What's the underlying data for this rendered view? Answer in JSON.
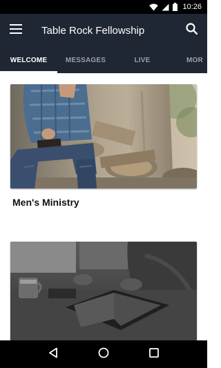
{
  "status_bar": {
    "time": "10:26",
    "icons": [
      "wifi-icon",
      "signal-icon",
      "battery-icon"
    ]
  },
  "app_bar": {
    "title": "Table Rock Fellowship",
    "icons": [
      "menu-icon",
      "search-icon"
    ]
  },
  "tabs": [
    {
      "label": "WELCOME",
      "active": true
    },
    {
      "label": "MESSAGES",
      "active": false
    },
    {
      "label": "LIVE",
      "active": false
    },
    {
      "label": "MOR",
      "active": false
    }
  ],
  "cards": [
    {
      "title": "Men's Ministry",
      "image": "man-sitting-with-bible-on-logs-photo"
    },
    {
      "title": "",
      "image": "open-bible-and-coffee-mug-bw-photo"
    }
  ],
  "nav_bar": {
    "icons": [
      "back-icon",
      "home-icon",
      "recents-icon"
    ]
  },
  "colors": {
    "app_bar": "#1f2734",
    "tab_active": "#ffffff",
    "tab_inactive": "#9aa0a8",
    "status_bar": "#000000"
  }
}
